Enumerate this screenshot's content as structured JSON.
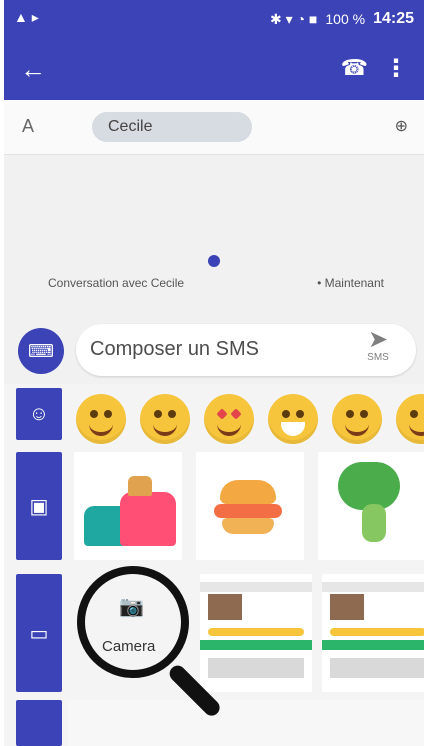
{
  "status": {
    "left_icons": "▲ ▸",
    "right_icons": "✱ ▾ ◔ ■",
    "battery": "100 %",
    "time": "14:25"
  },
  "toolbar": {
    "back_icon": "←",
    "call_icon": "☎",
    "more_icon": "⋮"
  },
  "recipient": {
    "to_label": "A",
    "contact_name": "Cecile",
    "add_contact_icon": "⊕"
  },
  "conversation": {
    "title": "Conversation avec Cecile",
    "time": "• Maintenant"
  },
  "composer": {
    "keyboard_icon": "⌨",
    "placeholder": "Composer un SMS",
    "send_icon": "➤",
    "send_label": "SMS"
  },
  "tabs": {
    "emoji_icon": "☺",
    "sticker_icon": "▣",
    "image_icon": "▭"
  },
  "camera": {
    "icon": "📷",
    "label": "Camera"
  }
}
